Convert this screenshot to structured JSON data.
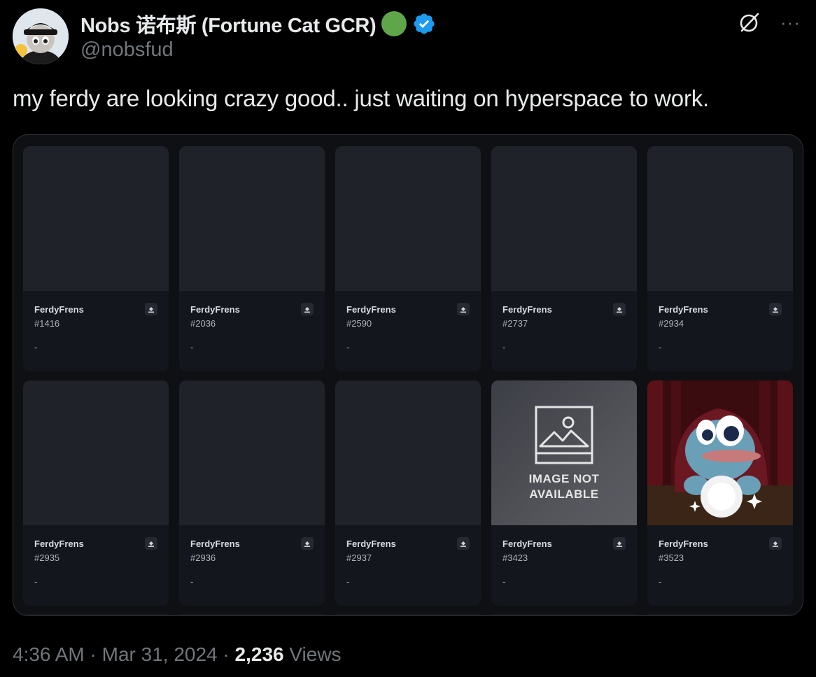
{
  "author": {
    "display_name": "Nobs 诺布斯 (Fortune Cat GCR)",
    "handle": "@nobsfud",
    "status_dot_color": "#5fa64a",
    "verified_color": "#1d9bf0"
  },
  "actions": {
    "grok_icon": "grok-icon",
    "more_label": "···"
  },
  "tweet": {
    "text": "my ferdy are looking crazy good.. just waiting on hyperspace to work."
  },
  "cards": [
    {
      "collection": "FerdyFrens",
      "number": "#1416",
      "price": "-"
    },
    {
      "collection": "FerdyFrens",
      "number": "#2036",
      "price": "-"
    },
    {
      "collection": "FerdyFrens",
      "number": "#2590",
      "price": "-"
    },
    {
      "collection": "FerdyFrens",
      "number": "#2737",
      "price": "-"
    },
    {
      "collection": "FerdyFrens",
      "number": "#2934",
      "price": "-"
    },
    {
      "collection": "FerdyFrens",
      "number": "#2935",
      "price": "-"
    },
    {
      "collection": "FerdyFrens",
      "number": "#2936",
      "price": "-"
    },
    {
      "collection": "FerdyFrens",
      "number": "#2937",
      "price": "-"
    },
    {
      "collection": "FerdyFrens",
      "number": "#3423",
      "price": "-",
      "image_text_1": "IMAGE NOT",
      "image_text_2": "AVAILABLE"
    },
    {
      "collection": "FerdyFrens",
      "number": "#3523",
      "price": "-"
    }
  ],
  "footer": {
    "time": "4:36 AM",
    "sep1": " · ",
    "date": "Mar 31, 2024",
    "sep2": " · ",
    "views_count": "2,236",
    "views_label": " Views"
  }
}
